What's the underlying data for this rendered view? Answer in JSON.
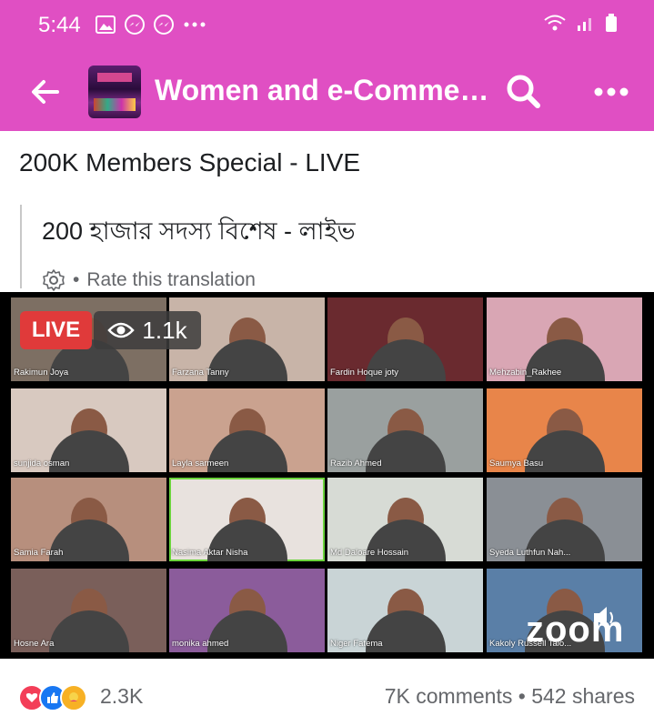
{
  "status": {
    "time": "5:44"
  },
  "appbar": {
    "title": "Women and e-Comme…"
  },
  "post": {
    "title": "200K Members Special - LIVE",
    "translation": "200 হাজার সদস্য বিশেষ - লাইভ",
    "rate_label": "Rate this translation"
  },
  "live": {
    "badge": "LIVE",
    "viewers": "1.1k",
    "zoom_label": "zoom"
  },
  "participants": [
    "Rakimun Joya",
    "Farzana Tanny",
    "Fardin Hoque joty",
    "Mehzabin_Rakhee",
    "sunjida osman",
    "Layla sarmeen",
    "Razib Ahmed",
    "Saumya Basu",
    "Samia Farah",
    "Nasima Aktar Nisha",
    "Md Daloare Hossain",
    "Syeda Luthfun Nah...",
    "Hosne Ara",
    "monika ahmed",
    "Niger Fatema",
    "Kakoly Russell Talo..."
  ],
  "footer": {
    "reactions_count": "2.3K",
    "comments": "7K comments",
    "separator": "•",
    "shares": "542 shares"
  },
  "colors": {
    "appbar": "#e04fc3",
    "live": "#e03a3a",
    "active_speaker": "#6bd33c"
  }
}
